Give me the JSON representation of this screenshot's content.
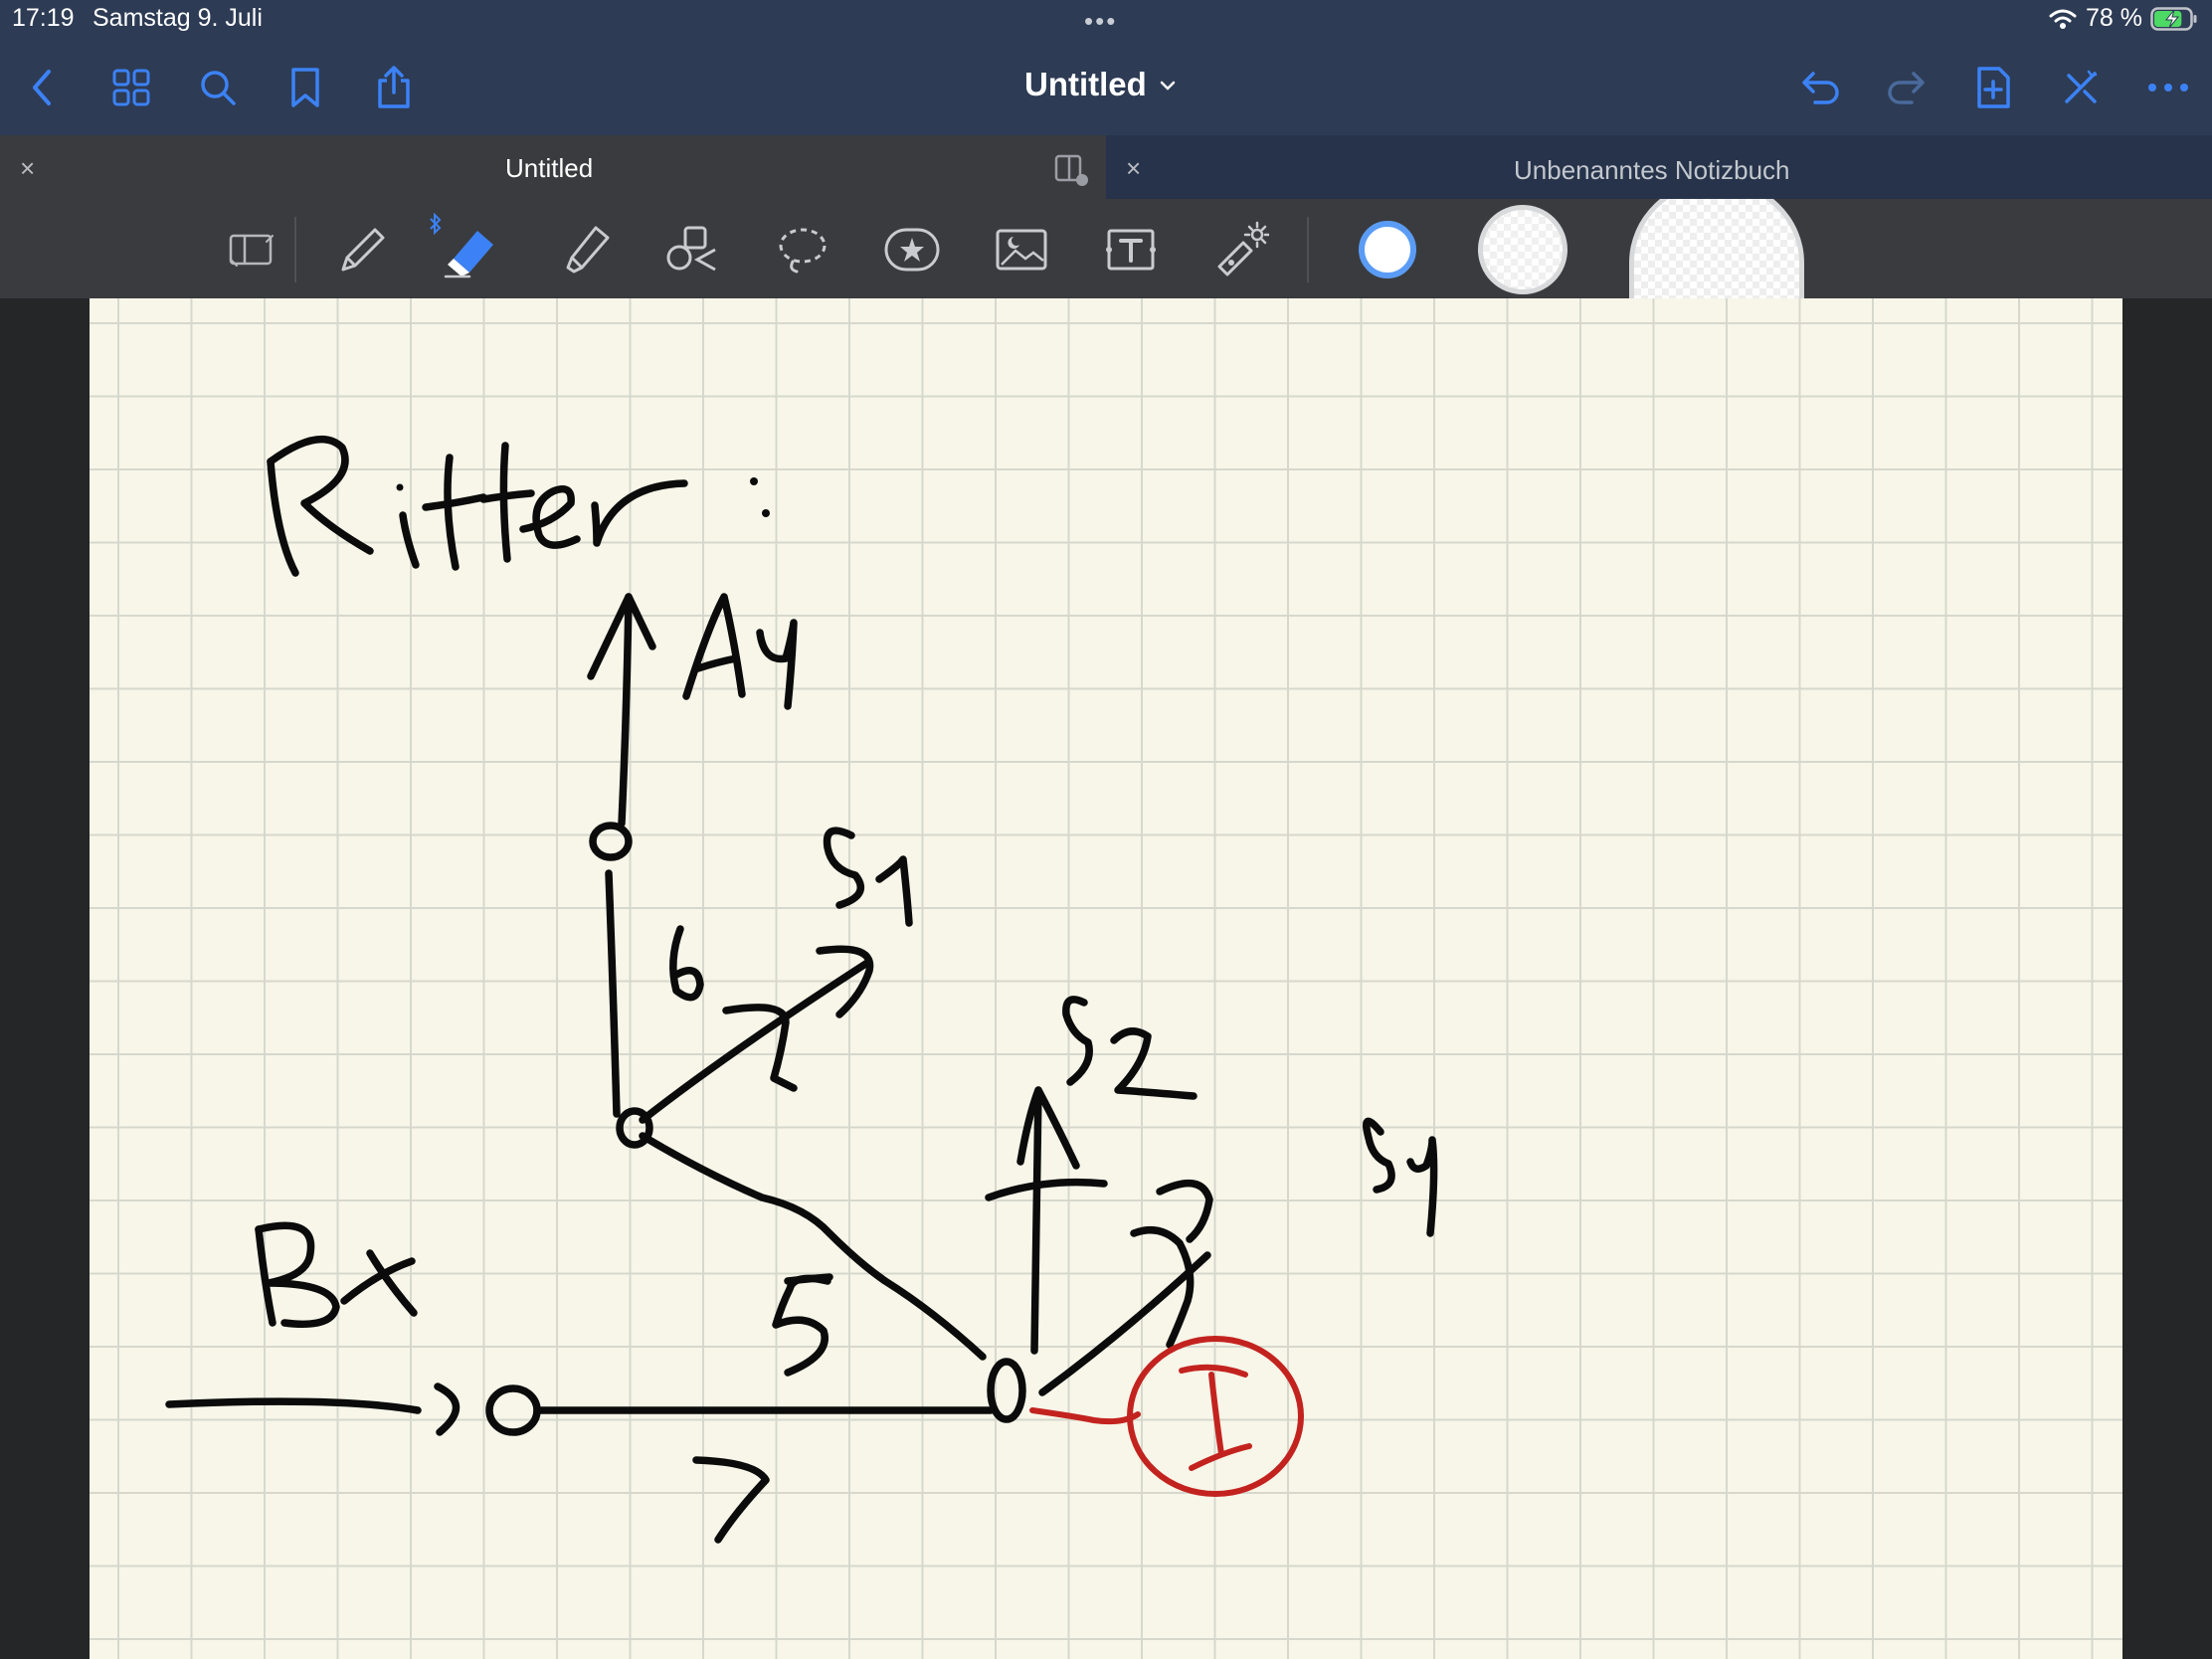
{
  "status_bar": {
    "time": "17:19",
    "date": "Samstag 9. Juli",
    "multitask_dots": "•••",
    "battery_percent": "78 %",
    "battery_level": 0.78,
    "charging": true
  },
  "nav_bar": {
    "title": "Untitled",
    "title_chevron": "⌄",
    "left_icons": [
      "back-chevron-icon",
      "grid-icon",
      "search-icon",
      "bookmark-icon",
      "share-icon"
    ],
    "right_icons": [
      "undo-icon",
      "redo-icon",
      "add-page-icon",
      "close-toolbar-icon",
      "more-icon"
    ],
    "accent_color": "#3c82f6"
  },
  "tabs": [
    {
      "label": "Untitled",
      "active": true,
      "close": "×"
    },
    {
      "label": "Unbenanntes Notizbuch",
      "active": false,
      "close": "×"
    }
  ],
  "toolbar": {
    "tools": [
      "sidebar-panel-icon",
      "pen-icon",
      "eraser-icon",
      "highlighter-icon",
      "shapes-icon",
      "lasso-icon",
      "sticker-icon",
      "image-icon",
      "text-box-icon",
      "laser-pointer-icon"
    ],
    "selected_tool": "eraser-icon",
    "bluetooth_indicator": "bluetooth-icon",
    "colors": [
      {
        "name": "small-eraser-size",
        "selected": true
      },
      {
        "name": "medium-eraser-size",
        "selected": false
      },
      {
        "name": "large-eraser-size",
        "selected": false
      }
    ]
  },
  "page": {
    "paper_color": "#f7f6e9",
    "grid_color": "#d7d8cd",
    "handwriting": {
      "heading": "Ritter :",
      "labels": [
        "Ay",
        "S1",
        "6",
        "S2",
        "Sy",
        "Bx",
        "5",
        "7",
        "I"
      ],
      "ink_color": "#0b0b0b",
      "highlight_ink_color": "#c3231f"
    }
  }
}
